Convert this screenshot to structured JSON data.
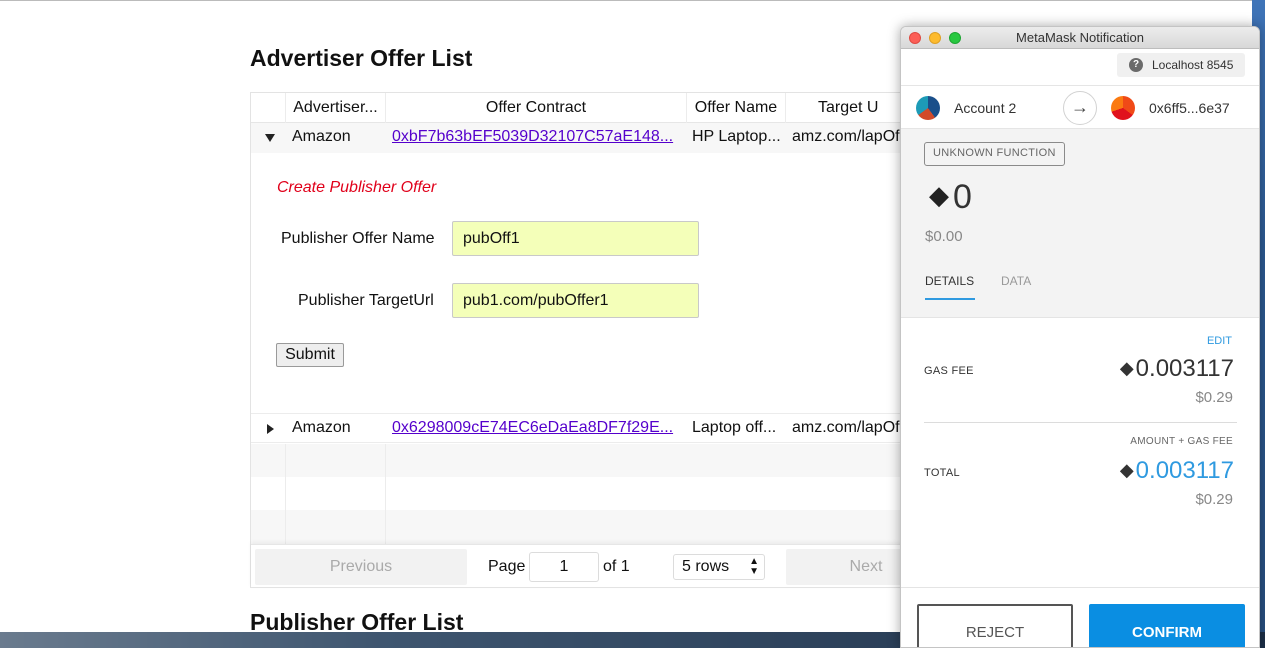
{
  "browser": {
    "advertiser_title": "Advertiser Offer List",
    "publisher_title": "Publisher Offer List",
    "table": {
      "headers": [
        "Advertiser...",
        "Offer Contract",
        "Offer Name",
        "Target U"
      ],
      "rows": [
        {
          "advertiser": "Amazon",
          "contract": "0xbF7b63bEF5039D32107C57aE148...",
          "offer_name": "HP Laptop...",
          "target": "amz.com/lapOf",
          "expanded": true
        },
        {
          "advertiser": "Amazon",
          "contract": "0x6298009cE74EC6eDaEa8DF7f29E...",
          "offer_name": "Laptop off...",
          "target": "amz.com/lapOf",
          "expanded": false
        }
      ]
    },
    "form": {
      "title": "Create Publisher Offer",
      "name_label": "Publisher Offer Name",
      "name_value": "pubOff1",
      "url_label": "Publisher TargetUrl",
      "url_value": "pub1.com/pubOffer1",
      "submit_label": "Submit"
    },
    "pagination": {
      "previous_label": "Previous",
      "next_label": "Next",
      "page_label": "Page",
      "page_value": "1",
      "of_label": "of 1",
      "rows_label": "5 rows"
    }
  },
  "metamask": {
    "window_title": "MetaMask Notification",
    "network": "Localhost 8545",
    "from_account": "Account 2",
    "to_account": "0x6ff5...6e37",
    "function_badge": "UNKNOWN FUNCTION",
    "amount": "0",
    "amount_usd": "$0.00",
    "tabs": [
      "DETAILS",
      "DATA"
    ],
    "edit_label": "EDIT",
    "gas_fee_label": "GAS FEE",
    "gas_fee_value": "0.003117",
    "gas_fee_usd": "$0.29",
    "amount_gas_label": "AMOUNT + GAS FEE",
    "total_label": "TOTAL",
    "total_value": "0.003117",
    "total_usd": "$0.29",
    "reject_label": "REJECT",
    "confirm_label": "CONFIRM",
    "colors": {
      "accent": "#0a8ee2",
      "link": "#2f9ae0"
    }
  }
}
